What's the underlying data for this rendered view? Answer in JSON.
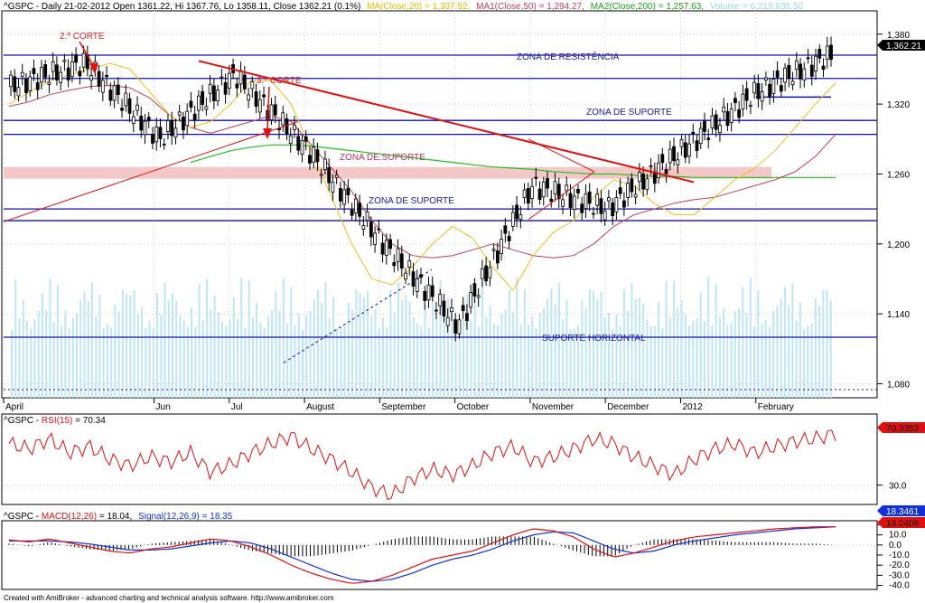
{
  "header": {
    "main": {
      "ticker": "^GSPC - Daily 21-02-2012 Open 1361.22, Hi 1367.76, Lo 1358.11, Close 1362.21 (0.1%)",
      "ma20": "MA(Close,20) = 1,337.92,",
      "ma50": "MA1(Close,50) = 1,294.27,",
      "ma200": "MA2(Close,200) = 1,257.63,",
      "volume": "Volume = 6,219,835.50"
    },
    "rsi": {
      "prefix": "^GSPC - ",
      "name": "RSI(15)",
      "value": " = 70.34"
    },
    "macd": {
      "prefix": "^GSPC - ",
      "name": "MACD(12,26)",
      "value": " = 18.04,",
      "signal": "Signal(12,26,9) = 18.35"
    }
  },
  "footer": "Created with AmiBroker - advanced charting and technical analysis software. http://www.amibroker.com",
  "annotations": {
    "corte2": "2.º CORTE",
    "corte3": "3.º CORTE",
    "zona_resistencia": "ZONA DE RESISTÊNCIA",
    "zona_suporte_1": "ZONA DE SUPORTE",
    "zona_suporte_2": "ZONA DE.SUPORTE",
    "zona_suporte_3": "ZONA DE SUPORTE",
    "suporte_horizontal": "SUPORTE HORIZONTAL"
  },
  "colors": {
    "candle": "#000000",
    "volume": "#bfe6f5",
    "ma20": "#f0c020",
    "ma50": "#c04060",
    "ma200": "#20c020",
    "level": "#1010b0",
    "trend": "#e01010",
    "zone": "#f5c8c8",
    "rsi": "#e01010",
    "macd": "#e01010",
    "signal": "#1030e0",
    "hist": "#000000"
  },
  "chart_data": [
    {
      "type": "candlestick",
      "title": "^GSPC - Daily 21-02-2012",
      "x_labels": [
        "April",
        "Jun",
        "Jul",
        "August",
        "September",
        "October",
        "November",
        "December",
        "2012",
        "February"
      ],
      "x_label_month_index": [
        0,
        2,
        3,
        4,
        5,
        6,
        7,
        8,
        9,
        10
      ],
      "month_start_points": [
        {
          "date": "2011-04-01",
          "close": 1335
        },
        {
          "date": "2011-05-01",
          "close": 1355
        },
        {
          "date": "2011-06-01",
          "close": 1290
        },
        {
          "date": "2011-07-01",
          "close": 1345
        },
        {
          "date": "2011-08-01",
          "close": 1280
        },
        {
          "date": "2011-09-01",
          "close": 1200
        },
        {
          "date": "2011-10-01",
          "close": 1130
        },
        {
          "date": "2011-11-01",
          "close": 1250
        },
        {
          "date": "2011-12-01",
          "close": 1230
        },
        {
          "date": "2012-01-01",
          "close": 1280
        },
        {
          "date": "2012-02-01",
          "close": 1330
        },
        {
          "date": "2012-02-21",
          "close": 1362
        }
      ],
      "y_ticks": [
        1080,
        1140,
        1200,
        1260,
        1320,
        1380
      ],
      "ylim": [
        1068,
        1400
      ],
      "last_value": "1,362.21",
      "horizontal_levels": [
        1362,
        1342,
        1306,
        1294,
        1230,
        1220,
        1120,
        1075
      ],
      "resistance_zone": [
        1256,
        1266
      ],
      "ma20": [
        1320,
        1330,
        1340,
        1345,
        1350,
        1355,
        1350,
        1330,
        1310,
        1300,
        1305,
        1320,
        1340,
        1340,
        1320,
        1280,
        1240,
        1200,
        1170,
        1165,
        1180,
        1200,
        1215,
        1205,
        1180,
        1160,
        1190,
        1210,
        1220,
        1240,
        1255,
        1250,
        1235,
        1225,
        1225,
        1240,
        1255,
        1265,
        1280,
        1300,
        1320,
        1338
      ],
      "ma50": [
        1318,
        1322,
        1328,
        1332,
        1335,
        1336,
        1334,
        1325,
        1310,
        1300,
        1295,
        1300,
        1305,
        1310,
        1305,
        1285,
        1265,
        1245,
        1220,
        1200,
        1190,
        1188,
        1190,
        1195,
        1200,
        1195,
        1190,
        1188,
        1190,
        1200,
        1215,
        1225,
        1230,
        1235,
        1238,
        1240,
        1245,
        1250,
        1255,
        1262,
        1275,
        1294
      ],
      "ma200": [
        null,
        null,
        null,
        null,
        null,
        null,
        null,
        null,
        null,
        1270,
        1275,
        1280,
        1283,
        1285,
        1285,
        1284,
        1282,
        1280,
        1278,
        1276,
        1274,
        1272,
        1270,
        1268,
        1266,
        1265,
        1264,
        1262,
        1261,
        1260,
        1260,
        1259,
        1258,
        1258,
        1257,
        1257,
        1257,
        1257,
        1257,
        1257,
        1257,
        1257
      ],
      "volume_level": 0.7
    },
    {
      "type": "line",
      "title": "RSI(15)",
      "series": [
        {
          "name": "RSI(15)",
          "values": [
            62,
            58,
            66,
            55,
            60,
            50,
            45,
            52,
            48,
            55,
            40,
            46,
            55,
            62,
            68,
            58,
            50,
            40,
            28,
            22,
            35,
            42,
            38,
            45,
            55,
            60,
            48,
            52,
            58,
            66,
            62,
            52,
            45,
            38,
            50,
            58,
            62,
            55,
            60,
            64,
            66,
            70
          ]
        }
      ],
      "y_ticks": [
        30
      ],
      "ylim": [
        15,
        85
      ],
      "last_value": "70.3353"
    },
    {
      "type": "line",
      "title": "MACD(12,26)",
      "series": [
        {
          "name": "MACD(12,26)",
          "values": [
            5,
            3,
            6,
            2,
            -2,
            -6,
            -8,
            -4,
            -2,
            2,
            6,
            4,
            -2,
            -10,
            -20,
            -28,
            -34,
            -38,
            -36,
            -30,
            -22,
            -14,
            -10,
            -6,
            2,
            10,
            16,
            14,
            8,
            -4,
            -12,
            -8,
            -2,
            4,
            8,
            10,
            12,
            14,
            16,
            17,
            18,
            18
          ]
        },
        {
          "name": "Signal(12,26,9)",
          "values": [
            4,
            4,
            4,
            3,
            1,
            -2,
            -5,
            -5,
            -4,
            -1,
            2,
            4,
            2,
            -4,
            -12,
            -20,
            -28,
            -34,
            -36,
            -34,
            -28,
            -20,
            -14,
            -10,
            -4,
            4,
            10,
            13,
            12,
            4,
            -4,
            -8,
            -6,
            0,
            4,
            7,
            10,
            12,
            14,
            16,
            17,
            18
          ]
        }
      ],
      "y_ticks": [
        20,
        10,
        0,
        -10,
        -20,
        -30,
        -40
      ],
      "y_tick_labels": [
        "20.0",
        "10.0",
        "0.0",
        "-10.0",
        "-20.0",
        "-30.0",
        "-40.0"
      ],
      "ylim": [
        -44,
        24
      ],
      "macd_last": "18.0406",
      "signal_last": "18.3461"
    }
  ]
}
